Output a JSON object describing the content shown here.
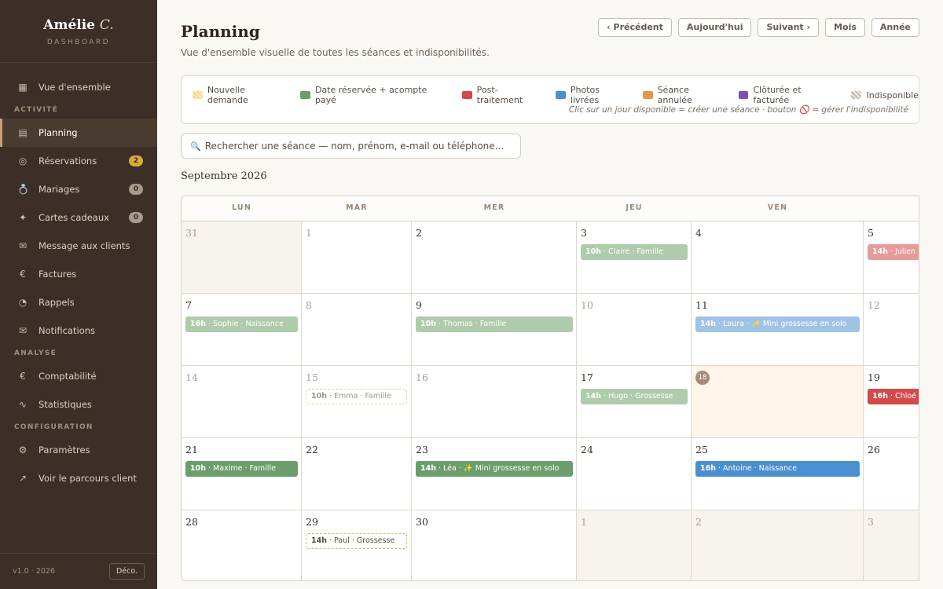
{
  "sidebar": {
    "brand_name": "Amélie",
    "brand_initial": "C.",
    "brand_sub": "DASHBOARD",
    "overview": {
      "label": "Vue d'ensemble",
      "icon": "grid-icon"
    },
    "sections": {
      "activity": "ACTIVITÉ",
      "analysis": "ANALYSE",
      "config": "CONFIGURATION"
    },
    "activity_items": [
      {
        "label": "Planning",
        "icon": "calendar-icon",
        "active": true
      },
      {
        "label": "Réservations",
        "icon": "target-icon",
        "badge": "2"
      },
      {
        "label": "Mariages",
        "icon": "ring-icon",
        "badge": "0"
      },
      {
        "label": "Cartes cadeaux",
        "icon": "sparkle-icon",
        "badge": "0"
      },
      {
        "label": "Message aux clients",
        "icon": "envelope-icon"
      },
      {
        "label": "Factures",
        "icon": "euro-icon"
      },
      {
        "label": "Rappels",
        "icon": "clock-icon"
      },
      {
        "label": "Notifications",
        "icon": "envelope-icon"
      }
    ],
    "analysis_items": [
      {
        "label": "Comptabilité",
        "icon": "euro-icon"
      },
      {
        "label": "Statistiques",
        "icon": "trend-icon"
      }
    ],
    "config_items": [
      {
        "label": "Paramètres",
        "icon": "gear-icon"
      },
      {
        "label": "Voir le parcours client",
        "icon": "arrow-up-right-icon"
      }
    ],
    "version": "v1.0 · 2026",
    "logout": "Déco."
  },
  "header": {
    "title": "Planning",
    "subtitle": "Vue d'ensemble visuelle de toutes les séances et indisponibilités.",
    "buttons": [
      "‹ Précédent",
      "Aujourd'hui",
      "Suivant ›",
      "Mois",
      "Année"
    ]
  },
  "legend": {
    "items": [
      {
        "label": "Nouvelle demande",
        "color": "#f3d98a"
      },
      {
        "label": "Date réservée + acompte payé",
        "color": "#6b9e6c"
      },
      {
        "label": "Post-traitement",
        "color": "#d24a4a"
      },
      {
        "label": "Photos livrées",
        "color": "#4a8fd0"
      },
      {
        "label": "Séance annulée",
        "color": "#e8954a"
      },
      {
        "label": "Clôturée et facturée",
        "color": "#7e4fb3"
      },
      {
        "label": "Indisponible",
        "color": "#c9bfb3"
      }
    ],
    "hint": "Clic sur un jour disponible = créer une séance · bouton 🚫 = gérer l'indisponibilité"
  },
  "search": {
    "placeholder": "Rechercher une séance — nom, prénom, e-mail ou téléphone…"
  },
  "calendar": {
    "month": "Septembre 2026",
    "weekdays": [
      "LUN",
      "MAR",
      "MER",
      "JEU",
      "VEN",
      "SA"
    ],
    "weeks": [
      [
        "31",
        "1",
        "2",
        "3",
        "4",
        "5"
      ],
      [
        "7",
        "8",
        "9",
        "10",
        "11",
        "12"
      ],
      [
        "14",
        "15",
        "16",
        "17",
        "18",
        "19"
      ],
      [
        "21",
        "22",
        "23",
        "24",
        "25",
        "26"
      ],
      [
        "28",
        "29",
        "30",
        "1",
        "2",
        "3"
      ]
    ],
    "today": "18",
    "events": [
      {
        "week": 0,
        "day": 3,
        "time": "10h",
        "text": "· Claire · Famille",
        "status": "reserved-l"
      },
      {
        "week": 0,
        "day": 5,
        "time": "14h",
        "text": "· Julien",
        "status": "post-l"
      },
      {
        "week": 1,
        "day": 0,
        "time": "16h",
        "text": "· Sophie · Naissance",
        "status": "reserved-l"
      },
      {
        "week": 1,
        "day": 2,
        "time": "10h",
        "text": "· Thomas · Famille",
        "status": "reserved-l"
      },
      {
        "week": 1,
        "day": 4,
        "time": "14h",
        "text": "· Laura · ✨ Mini grossesse en solo",
        "status": "delivered-l"
      },
      {
        "week": 2,
        "day": 1,
        "time": "10h",
        "text": "· Emma · Famille",
        "status": "pending-l"
      },
      {
        "week": 2,
        "day": 3,
        "time": "14h",
        "text": "· Hugo · Grossesse",
        "status": "reserved-l"
      },
      {
        "week": 2,
        "day": 5,
        "time": "16h",
        "text": "· Chloé",
        "status": "post"
      },
      {
        "week": 3,
        "day": 0,
        "time": "10h",
        "text": "· Maxime · Famille",
        "status": "reserved"
      },
      {
        "week": 3,
        "day": 2,
        "time": "14h",
        "text": "· Léa · ✨ Mini grossesse en solo",
        "status": "reserved"
      },
      {
        "week": 3,
        "day": 4,
        "time": "16h",
        "text": "· Antoine · Naissance",
        "status": "delivered"
      },
      {
        "week": 4,
        "day": 1,
        "time": "14h",
        "text": "· Paul · Grossesse",
        "status": "pending"
      }
    ]
  }
}
